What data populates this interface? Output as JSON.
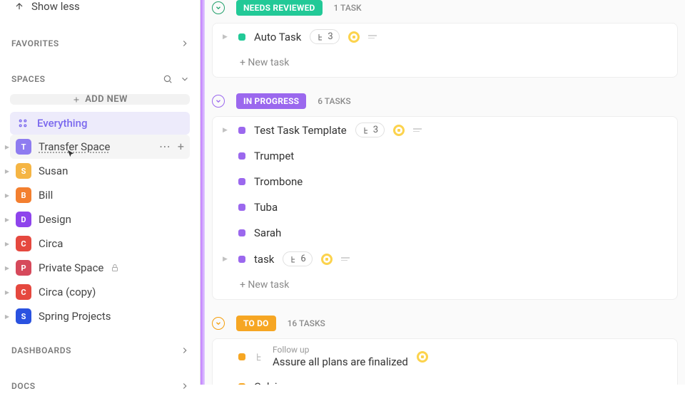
{
  "sidebar": {
    "show_less": "Show less",
    "favorites_label": "FAVORITES",
    "spaces_label": "SPACES",
    "add_new": "ADD NEW",
    "dashboards_label": "DASHBOARDS",
    "docs_label": "DOCS",
    "everything": "Everything",
    "spaces": [
      {
        "letter": "T",
        "name": "Transfer Space",
        "color": "#8e7cf0",
        "hovered": true
      },
      {
        "letter": "S",
        "name": "Susan",
        "color": "#f5b544"
      },
      {
        "letter": "B",
        "name": "Bill",
        "color": "#f37f2f"
      },
      {
        "letter": "D",
        "name": "Design",
        "color": "#8e44ec"
      },
      {
        "letter": "C",
        "name": "Circa",
        "color": "#e5483f"
      },
      {
        "letter": "P",
        "name": "Private Space",
        "color": "#d6495b",
        "locked": true
      },
      {
        "letter": "C",
        "name": "Circa (copy)",
        "color": "#e5483f"
      },
      {
        "letter": "S",
        "name": "Spring Projects",
        "color": "#2a52e0"
      }
    ]
  },
  "groups": [
    {
      "status": "NEEDS REVIEWED",
      "color": "green",
      "count": "1 TASK",
      "tasks": [
        {
          "name": "Auto Task",
          "sub": "3",
          "tag": true,
          "lines": true,
          "tri": true
        }
      ],
      "new_task": "+ New task"
    },
    {
      "status": "IN PROGRESS",
      "color": "purple",
      "count": "6 TASKS",
      "tasks": [
        {
          "name": "Test Task Template",
          "sub": "3",
          "tag": true,
          "lines": true,
          "tri": true
        },
        {
          "name": "Trumpet"
        },
        {
          "name": "Trombone"
        },
        {
          "name": "Tuba"
        },
        {
          "name": "Sarah"
        },
        {
          "name": "task",
          "sub": "6",
          "tag": true,
          "lines": true,
          "tri": true
        }
      ],
      "new_task": "+ New task"
    },
    {
      "status": "TO DO",
      "color": "orange",
      "count": "16 TASKS",
      "tasks": [
        {
          "parent": "Follow up",
          "name": "Assure all plans are finalized",
          "tag": true,
          "parent_icon": true
        },
        {
          "name": "Calvin",
          "lines": true
        }
      ]
    }
  ]
}
